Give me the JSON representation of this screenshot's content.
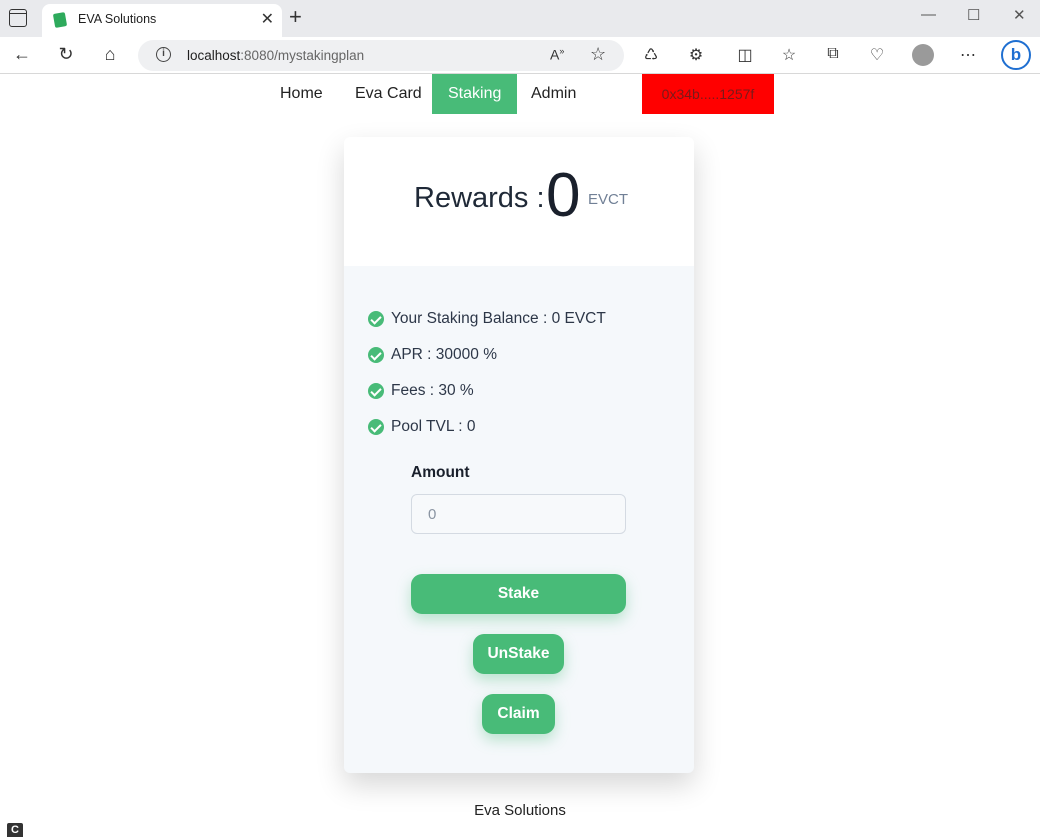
{
  "browser": {
    "tab_title": "EVA Solutions",
    "tab_close": "✕",
    "new_tab": "+",
    "url_host": "localhost",
    "url_path": ":8080/mystakingplan",
    "read_aloud": "A͉",
    "window_controls": {
      "minimize": "—",
      "maximize": "☐",
      "close": "✕"
    }
  },
  "nav": {
    "home": "Home",
    "eva_card": "Eva Card",
    "staking": "Staking",
    "admin": "Admin",
    "wallet": "0x34b.....1257f"
  },
  "rewards": {
    "label": "Rewards :",
    "value": "0",
    "unit": "EVCT"
  },
  "features": [
    "Your Staking Balance : 0 EVCT",
    "APR : 30000 %",
    "Fees : 30 %",
    "Pool TVL : 0"
  ],
  "amount": {
    "label": "Amount",
    "placeholder": "0"
  },
  "buttons": {
    "stake": "Stake",
    "unstake": "UnStake",
    "claim": "Claim"
  },
  "footer": "Eva Solutions",
  "colors": {
    "accent": "#48bb78",
    "wallet_bg": "#ff0000"
  }
}
